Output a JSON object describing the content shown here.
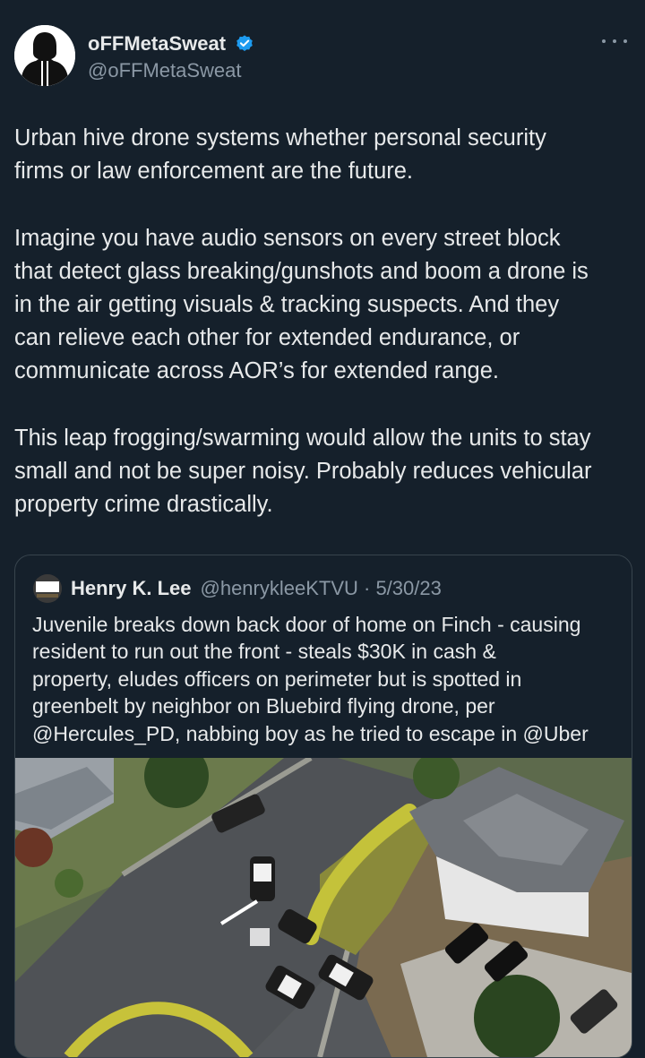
{
  "author": {
    "display_name": "oFFMetaSweat",
    "handle": "@oFFMetaSweat",
    "avatar_icon": "hooded-figure-icon",
    "verified_icon": "verified-badge-icon",
    "verified_color": "#1d9bf0"
  },
  "more_icon": "more-options-icon",
  "tweet": {
    "paragraphs": [
      [
        "Urban hive drone systems whether personal security",
        "firms or law enforcement are the future."
      ],
      [
        "Imagine you have audio sensors on every street block",
        "that detect glass breaking/gunshots and boom a drone is",
        "in the air getting visuals & tracking suspects. And they",
        "can relieve each other for extended endurance, or",
        "communicate across AOR’s for extended range."
      ],
      [
        "This leap frogging/swarming would allow the units to stay",
        "small and not be super noisy. Probably reduces vehicular",
        "property crime drastically."
      ]
    ]
  },
  "quoted": {
    "display_name": "Henry K. Lee",
    "handle_and_date": "@henrykleeKTVU · 5/30/23",
    "avatar_text": "FOX",
    "lines": [
      "Juvenile breaks down back door of home on Finch - causing",
      "resident to run out the front - steals $30K in cash &",
      "property, eludes officers on perimeter but is spotted in",
      "greenbelt by neighbor on Bluebird flying drone, per",
      "@Hercules_PD, nabbing boy as he tried to escape in @Uber"
    ],
    "media_description_icon": "aerial-drone-photo"
  },
  "colors": {
    "background": "#15202b",
    "text": "#e7e9ea",
    "secondary_text": "#8b98a5",
    "border": "#38444d"
  }
}
